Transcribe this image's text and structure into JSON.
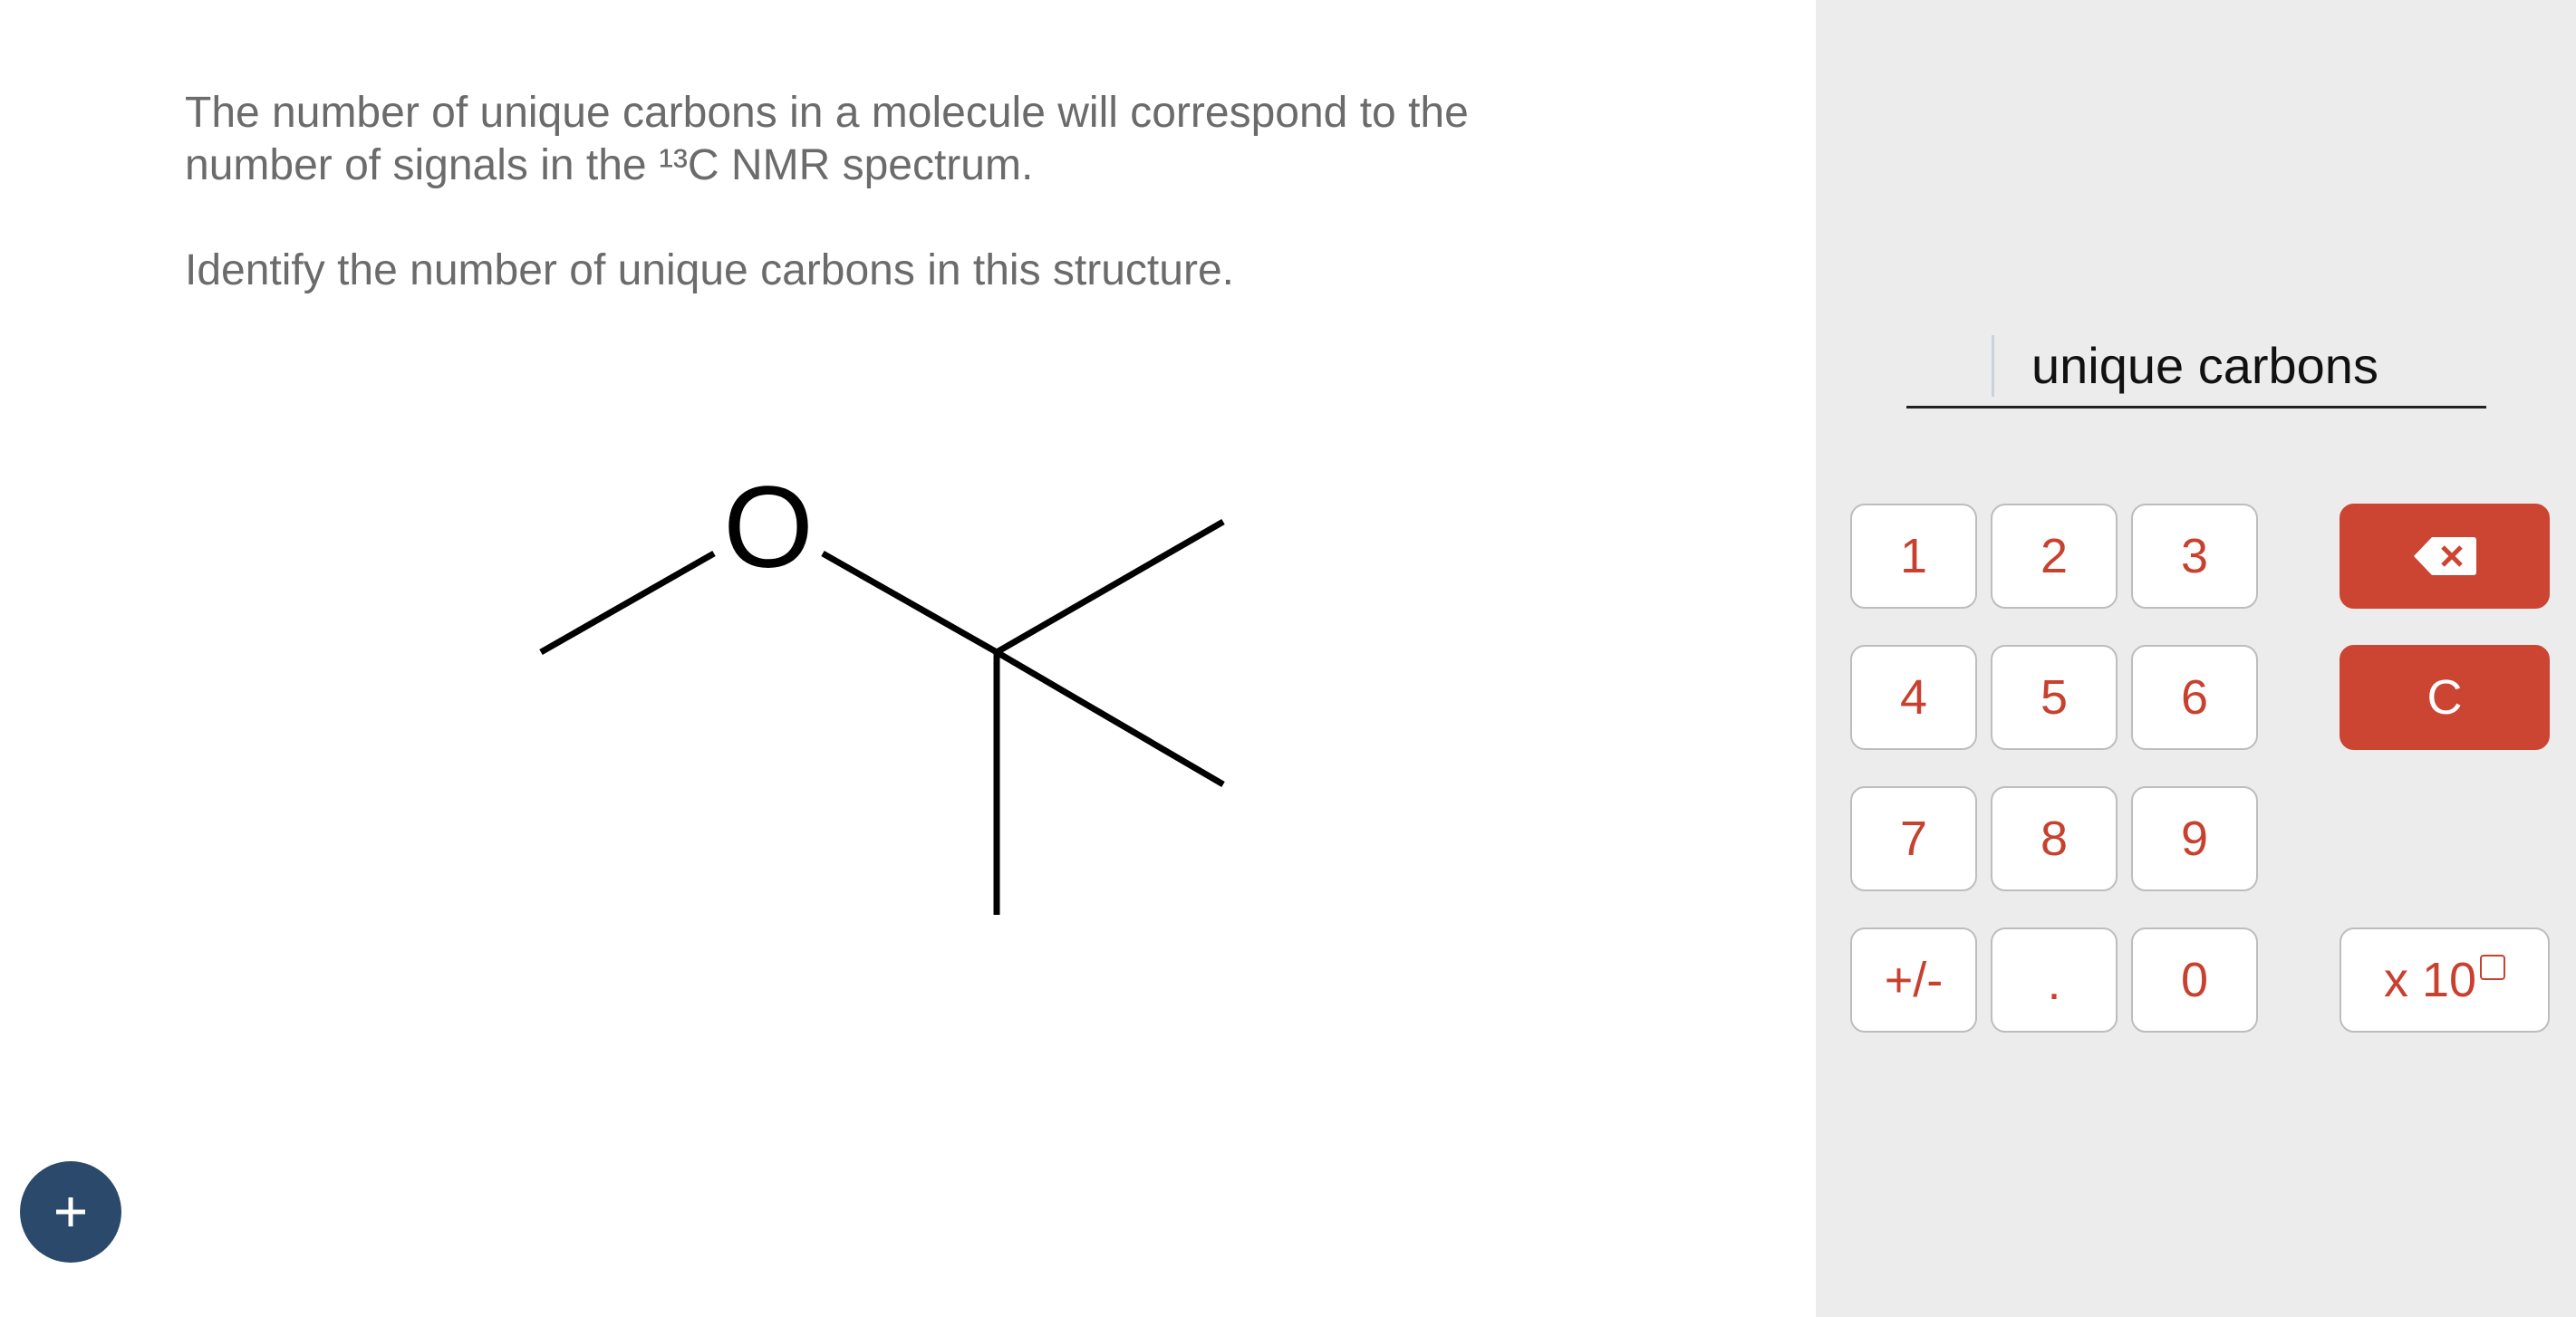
{
  "question": {
    "line1": "The number of unique carbons in a molecule will correspond to the",
    "line2": "number of signals in the ¹³C NMR spectrum.",
    "instruction": "Identify the number of unique carbons in this structure.",
    "atom_label": "O"
  },
  "answer": {
    "value": "",
    "unit": "unique carbons"
  },
  "keypad": {
    "k1": "1",
    "k2": "2",
    "k3": "3",
    "k4": "4",
    "k5": "5",
    "k6": "6",
    "k7": "7",
    "k8": "8",
    "k9": "9",
    "sign": "+/-",
    "dot": ".",
    "k0": "0",
    "clear": "C",
    "sci": "x 10"
  },
  "colors": {
    "accent": "#cc4432",
    "fab": "#2b4a6b",
    "panel": "#ececec"
  },
  "icons": {
    "backspace": "backspace-icon",
    "add": "plus-icon"
  }
}
